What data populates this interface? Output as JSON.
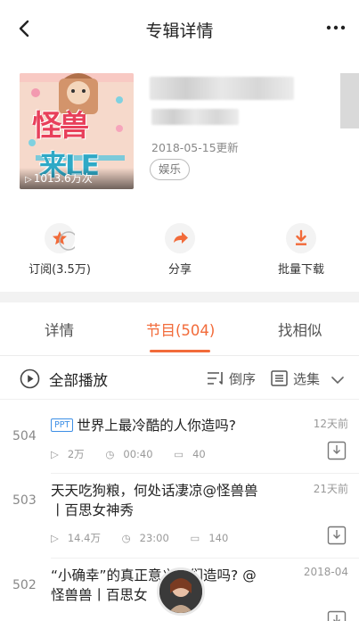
{
  "header": {
    "title": "专辑详情"
  },
  "album": {
    "cover_play_count": "1013.6万次",
    "cover_art_text": [
      "怪兽",
      "来LE"
    ],
    "update_date": "2018-05-15更新",
    "category_tag": "娱乐"
  },
  "actions": [
    {
      "label": "订阅(3.5万)",
      "icon": "star-icon"
    },
    {
      "label": "分享",
      "icon": "share-arrow-icon"
    },
    {
      "label": "批量下载",
      "icon": "download-icon"
    }
  ],
  "tabs": [
    {
      "label": "详情"
    },
    {
      "label": "节目(504)"
    },
    {
      "label": "找相似"
    }
  ],
  "playbar": {
    "play_all": "全部播放",
    "sort": "倒序",
    "select": "选集"
  },
  "episodes": [
    {
      "num": "504",
      "badge": "PPT",
      "title": "世界上最冷酷的人你造吗?",
      "time": "12天前",
      "plays": "2万",
      "duration": "00:40",
      "comments": "40"
    },
    {
      "num": "503",
      "badge": "",
      "title": "天天吃狗粮，何处话凄凉@怪兽兽丨百思女神秀",
      "time": "21天前",
      "plays": "14.4万",
      "duration": "23:00",
      "comments": "140"
    },
    {
      "num": "502",
      "badge": "",
      "title": "“小确幸”的真正意义你们造吗? @怪兽兽丨百思女",
      "time": "2018-04",
      "plays": "",
      "duration": "",
      "comments": ""
    }
  ],
  "colors": {
    "accent": "#f26b3a",
    "ppt_badge": "#3d8fe6"
  }
}
